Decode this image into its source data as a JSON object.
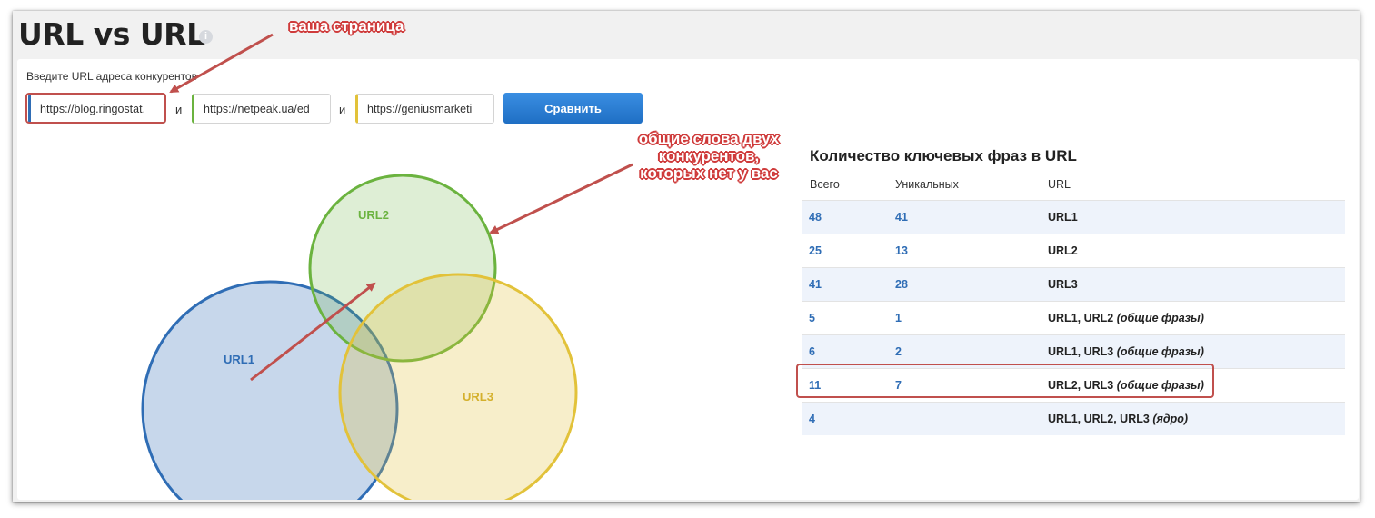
{
  "header": {
    "title": "URL vs URL",
    "info_icon": "i"
  },
  "form": {
    "label": "Введите URL адреса конкурентов",
    "url1": "https://blog.ringostat.",
    "url2": "https://netpeak.ua/ed",
    "url3": "https://geniusmarketi",
    "and_label": "и",
    "compare_button": "Сравнить"
  },
  "venn": {
    "labels": [
      "URL1",
      "URL2",
      "URL3"
    ],
    "colors": {
      "url1": "#2f6db5",
      "url2": "#6bb33f",
      "url3": "#e2c23a"
    }
  },
  "table": {
    "title": "Количество ключевых фраз в URL",
    "headers": [
      "Всего",
      "Уникальных",
      "URL"
    ],
    "rows": [
      {
        "total": "48",
        "unique": "41",
        "url": "URL1",
        "note": ""
      },
      {
        "total": "25",
        "unique": "13",
        "url": "URL2",
        "note": ""
      },
      {
        "total": "41",
        "unique": "28",
        "url": "URL3",
        "note": ""
      },
      {
        "total": "5",
        "unique": "1",
        "url": "URL1, URL2",
        "note": "(общие фразы)"
      },
      {
        "total": "6",
        "unique": "2",
        "url": "URL1, URL3",
        "note": "(общие фразы)"
      },
      {
        "total": "11",
        "unique": "7",
        "url": "URL2, URL3",
        "note": "(общие фразы)"
      },
      {
        "total": "4",
        "unique": "",
        "url": "URL1, URL2, URL3",
        "note": "(ядро)"
      }
    ]
  },
  "annotations": {
    "your_page": "ваша страница",
    "common_words": [
      "общие слова двух",
      "конкурентов,",
      "которых нет у вас"
    ],
    "color": "#c0504d"
  }
}
